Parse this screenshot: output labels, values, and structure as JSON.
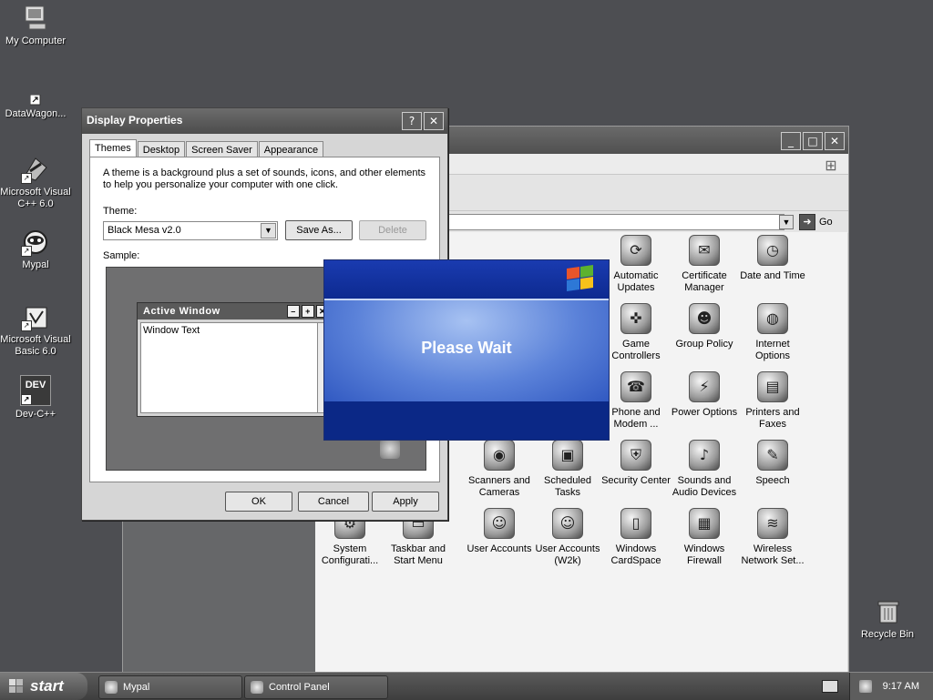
{
  "desktop": {
    "icons": [
      {
        "label": "My Computer",
        "icon": "computer-icon"
      },
      {
        "label": "DataWagon...",
        "icon": "shortcut-icon"
      },
      {
        "label": "Microsoft Visual C++ 6.0",
        "icon": "visual-cpp-icon"
      },
      {
        "label": "Mypal",
        "icon": "mypal-icon"
      },
      {
        "label": "Microsoft Visual Basic 6.0",
        "icon": "visual-basic-icon"
      },
      {
        "label": "Dev-C++",
        "icon": "dev-cpp-icon"
      },
      {
        "label": "Recycle Bin",
        "icon": "recycle-bin-icon"
      }
    ],
    "dev_icon_text": "DEV"
  },
  "control_panel": {
    "go_label": "Go",
    "items": [
      {
        "label": "Automatic Updates",
        "icon": "automatic-updates-icon",
        "glyph": "⟳"
      },
      {
        "label": "Certificate Manager",
        "icon": "certificate-icon",
        "glyph": "✉"
      },
      {
        "label": "Date and Time",
        "icon": "clock-icon",
        "glyph": "◷"
      },
      {
        "label": "Game Controllers",
        "icon": "gamepad-icon",
        "glyph": "✜"
      },
      {
        "label": "Group Policy",
        "icon": "group-policy-icon",
        "glyph": "☻"
      },
      {
        "label": "Internet Options",
        "icon": "globe-icon",
        "glyph": "◍"
      },
      {
        "label": "Phone and Modem ...",
        "icon": "phone-icon",
        "glyph": "☎"
      },
      {
        "label": "Power Options",
        "icon": "power-icon",
        "glyph": "⚡"
      },
      {
        "label": "Printers and Faxes",
        "icon": "printer-icon",
        "glyph": "▤"
      },
      {
        "label": "Scanners and Cameras",
        "icon": "scanner-icon",
        "glyph": "◉"
      },
      {
        "label": "Scheduled Tasks",
        "icon": "folder-clock-icon",
        "glyph": "▣"
      },
      {
        "label": "Security Center",
        "icon": "shield-icon",
        "glyph": "⛨"
      },
      {
        "label": "Sounds and Audio Devices",
        "icon": "speaker-icon",
        "glyph": "♪"
      },
      {
        "label": "Speech",
        "icon": "speech-icon",
        "glyph": "✎"
      },
      {
        "label": "System Configurati...",
        "icon": "system-config-icon",
        "glyph": "⚙"
      },
      {
        "label": "Taskbar and Start Menu",
        "icon": "taskbar-icon",
        "glyph": "▭"
      },
      {
        "label": "User Accounts",
        "icon": "users-icon",
        "glyph": "☺"
      },
      {
        "label": "User Accounts (W2k)",
        "icon": "users-key-icon",
        "glyph": "☺"
      },
      {
        "label": "Windows CardSpace",
        "icon": "cardspace-icon",
        "glyph": "▯"
      },
      {
        "label": "Windows Firewall",
        "icon": "firewall-icon",
        "glyph": "▦"
      },
      {
        "label": "Wireless Network Set...",
        "icon": "wireless-icon",
        "glyph": "≋"
      }
    ]
  },
  "display_properties": {
    "title": "Display Properties",
    "help_glyph": "?",
    "close_glyph": "✕",
    "tabs": [
      {
        "label": "Themes",
        "active": true
      },
      {
        "label": "Desktop",
        "active": false
      },
      {
        "label": "Screen Saver",
        "active": false
      },
      {
        "label": "Appearance",
        "active": false
      }
    ],
    "description": "A theme is a background plus a set of sounds, icons, and other elements to help you personalize your computer with one click.",
    "theme_label": "Theme:",
    "theme_value": "Black Mesa v2.0",
    "save_as_label": "Save As...",
    "delete_label": "Delete",
    "sample_label": "Sample:",
    "sample_window_title": "Active Window",
    "sample_window_text": "Window Text",
    "ok_label": "OK",
    "cancel_label": "Cancel",
    "apply_label": "Apply"
  },
  "please_wait": {
    "message": "Please Wait"
  },
  "taskbar": {
    "start_label": "start",
    "buttons": [
      {
        "label": "Mypal",
        "icon": "mypal-icon"
      },
      {
        "label": "Control Panel",
        "icon": "control-panel-icon"
      }
    ],
    "clock": "9:17 AM"
  },
  "colors": {
    "wait_blue": "#0e2b8e",
    "desktop": "#4d4e52"
  }
}
